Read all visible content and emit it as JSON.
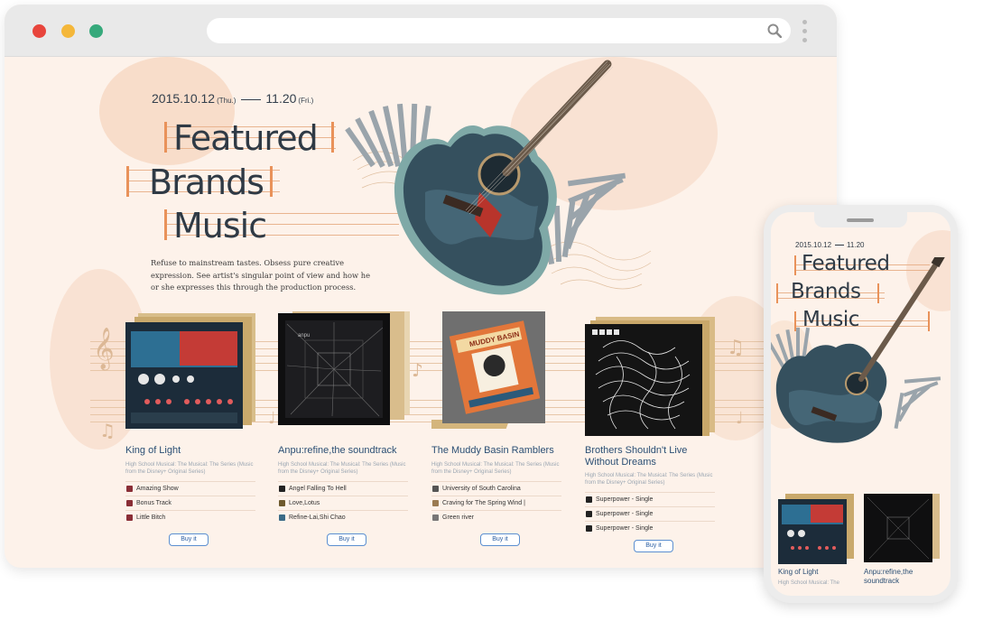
{
  "browser": {
    "controls": [
      "close",
      "minimize",
      "maximize"
    ],
    "url": "",
    "icons": {
      "search": "search-icon",
      "menu": "kebab-menu-icon"
    }
  },
  "hero": {
    "date_start": "2015.10.12",
    "date_start_day": "(Thu.)",
    "date_end": "11.20",
    "date_end_day": "(Fri.)",
    "title_words": [
      "Featured",
      "Brands",
      "Music"
    ],
    "tagline": "Refuse to mainstream tastes. Obsess pure creative expression. See artist's singular point of view and how he or she expresses this through the production process."
  },
  "albums": [
    {
      "name": "King of Light",
      "subtitle": "High School Musical: The Musical: The Series (Music from the Disney+ Original Series)",
      "tracks": [
        "Amazing Show",
        "Bonus Track",
        "Little Bitch"
      ],
      "buy_label": "Buy it"
    },
    {
      "name": "Anpu:refine,the soundtrack",
      "subtitle": "High School Musical: The Musical: The Series (Music from the Disney+ Original Series)",
      "tracks": [
        "Angel Falling To Hell",
        "Love,Lotus",
        "Refine-Lai,Shi Chao"
      ],
      "buy_label": "Buy it",
      "cover_text": "anpu"
    },
    {
      "name": "The Muddy Basin Ramblers",
      "subtitle": "High School Musical: The Musical: The Series (Music from the Disney+ Original Series)",
      "tracks": [
        "University of South Carolina",
        "Craving for The Spring Wind |",
        "Green river"
      ],
      "buy_label": "Buy it",
      "cover_text": "MUDDY BASIN"
    },
    {
      "name": "Brothers Shouldn't Live Without Dreams",
      "subtitle": "High School Musical: The Musical: The Series (Music from the Disney+ Original Series)",
      "tracks": [
        "Superpower - Single",
        "Superpower - Single",
        "Superpower - Single"
      ],
      "buy_label": "Buy it"
    }
  ],
  "mobile": {
    "date_start": "2015.10.12",
    "date_end": "11.20",
    "title_words": [
      "Featured",
      "Brands",
      "Music"
    ],
    "cards": [
      {
        "name": "King of Light",
        "subtitle": "High School Musical: The"
      },
      {
        "name": "Anpu:refine,the soundtrack",
        "subtitle": ""
      }
    ]
  },
  "colors": {
    "page_bg": "#fdf2ea",
    "accent_orange": "#e9925a",
    "title_text": "#2f3a45",
    "album_name": "#2b4f74",
    "button_border": "#5b8fd0"
  }
}
